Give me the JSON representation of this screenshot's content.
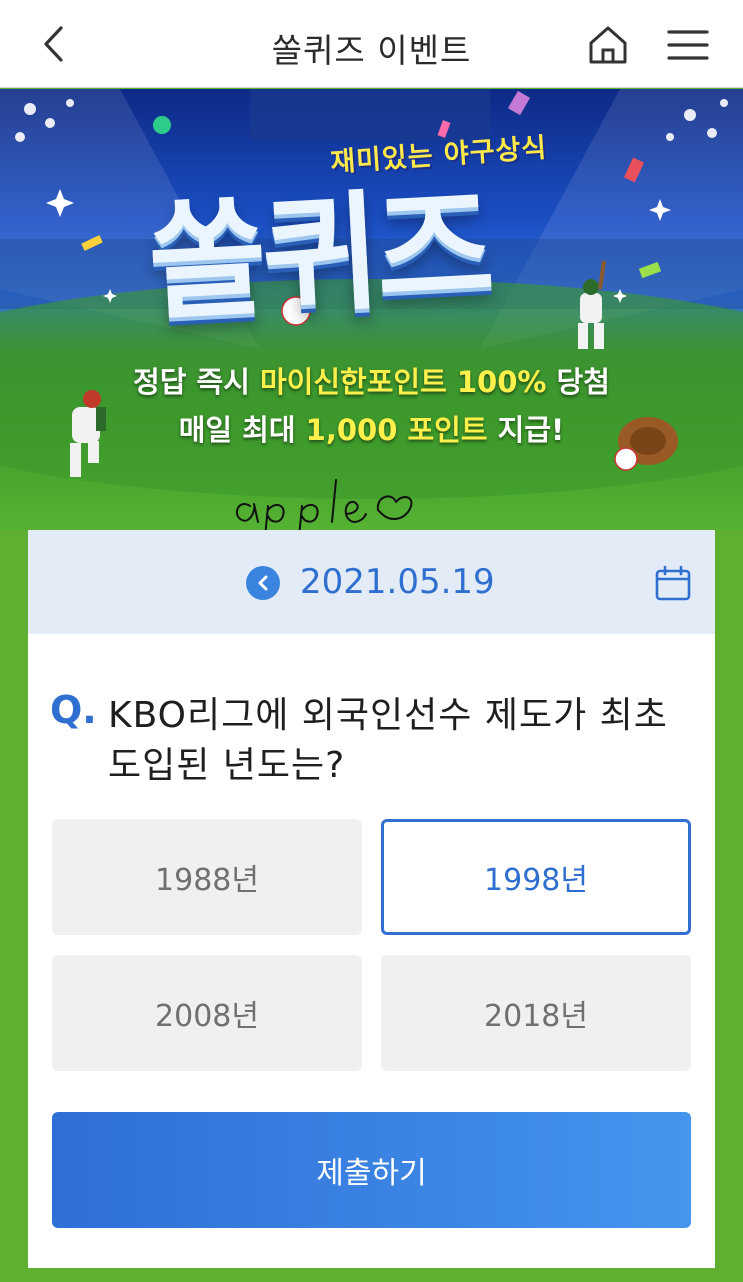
{
  "header": {
    "title": "쏠퀴즈 이벤트",
    "icons": {
      "back": "chevron-left-icon",
      "home": "home-icon",
      "menu": "hamburger-menu-icon"
    }
  },
  "banner": {
    "subtitle": "재미있는 야구상식",
    "title": "쏠퀴즈",
    "line1_prefix": "정답 즉시 ",
    "line1_highlight": "마이신한포인트 100%",
    "line1_suffix": " 당첨",
    "line2_prefix": "매일 최대 ",
    "line2_highlight": "1,000 포인트",
    "line2_suffix": " 지급!",
    "handwriting": "apple♡"
  },
  "quiz": {
    "date": "2021.05.19",
    "question_mark": "Q.",
    "question_line1": "KBO리그에 외국인선수 제도가 최초",
    "question_line2": "도입된 년도는?",
    "options": [
      {
        "label": "1988년",
        "selected": false
      },
      {
        "label": "1998년",
        "selected": true
      },
      {
        "label": "2008년",
        "selected": false
      },
      {
        "label": "2018년",
        "selected": false
      }
    ],
    "submit_label": "제출하기"
  },
  "colors": {
    "accent": "#2f6fd0",
    "background_green": "#5fb030",
    "date_bar": "#e3ecf6",
    "highlight_yellow": "#fff04c"
  }
}
